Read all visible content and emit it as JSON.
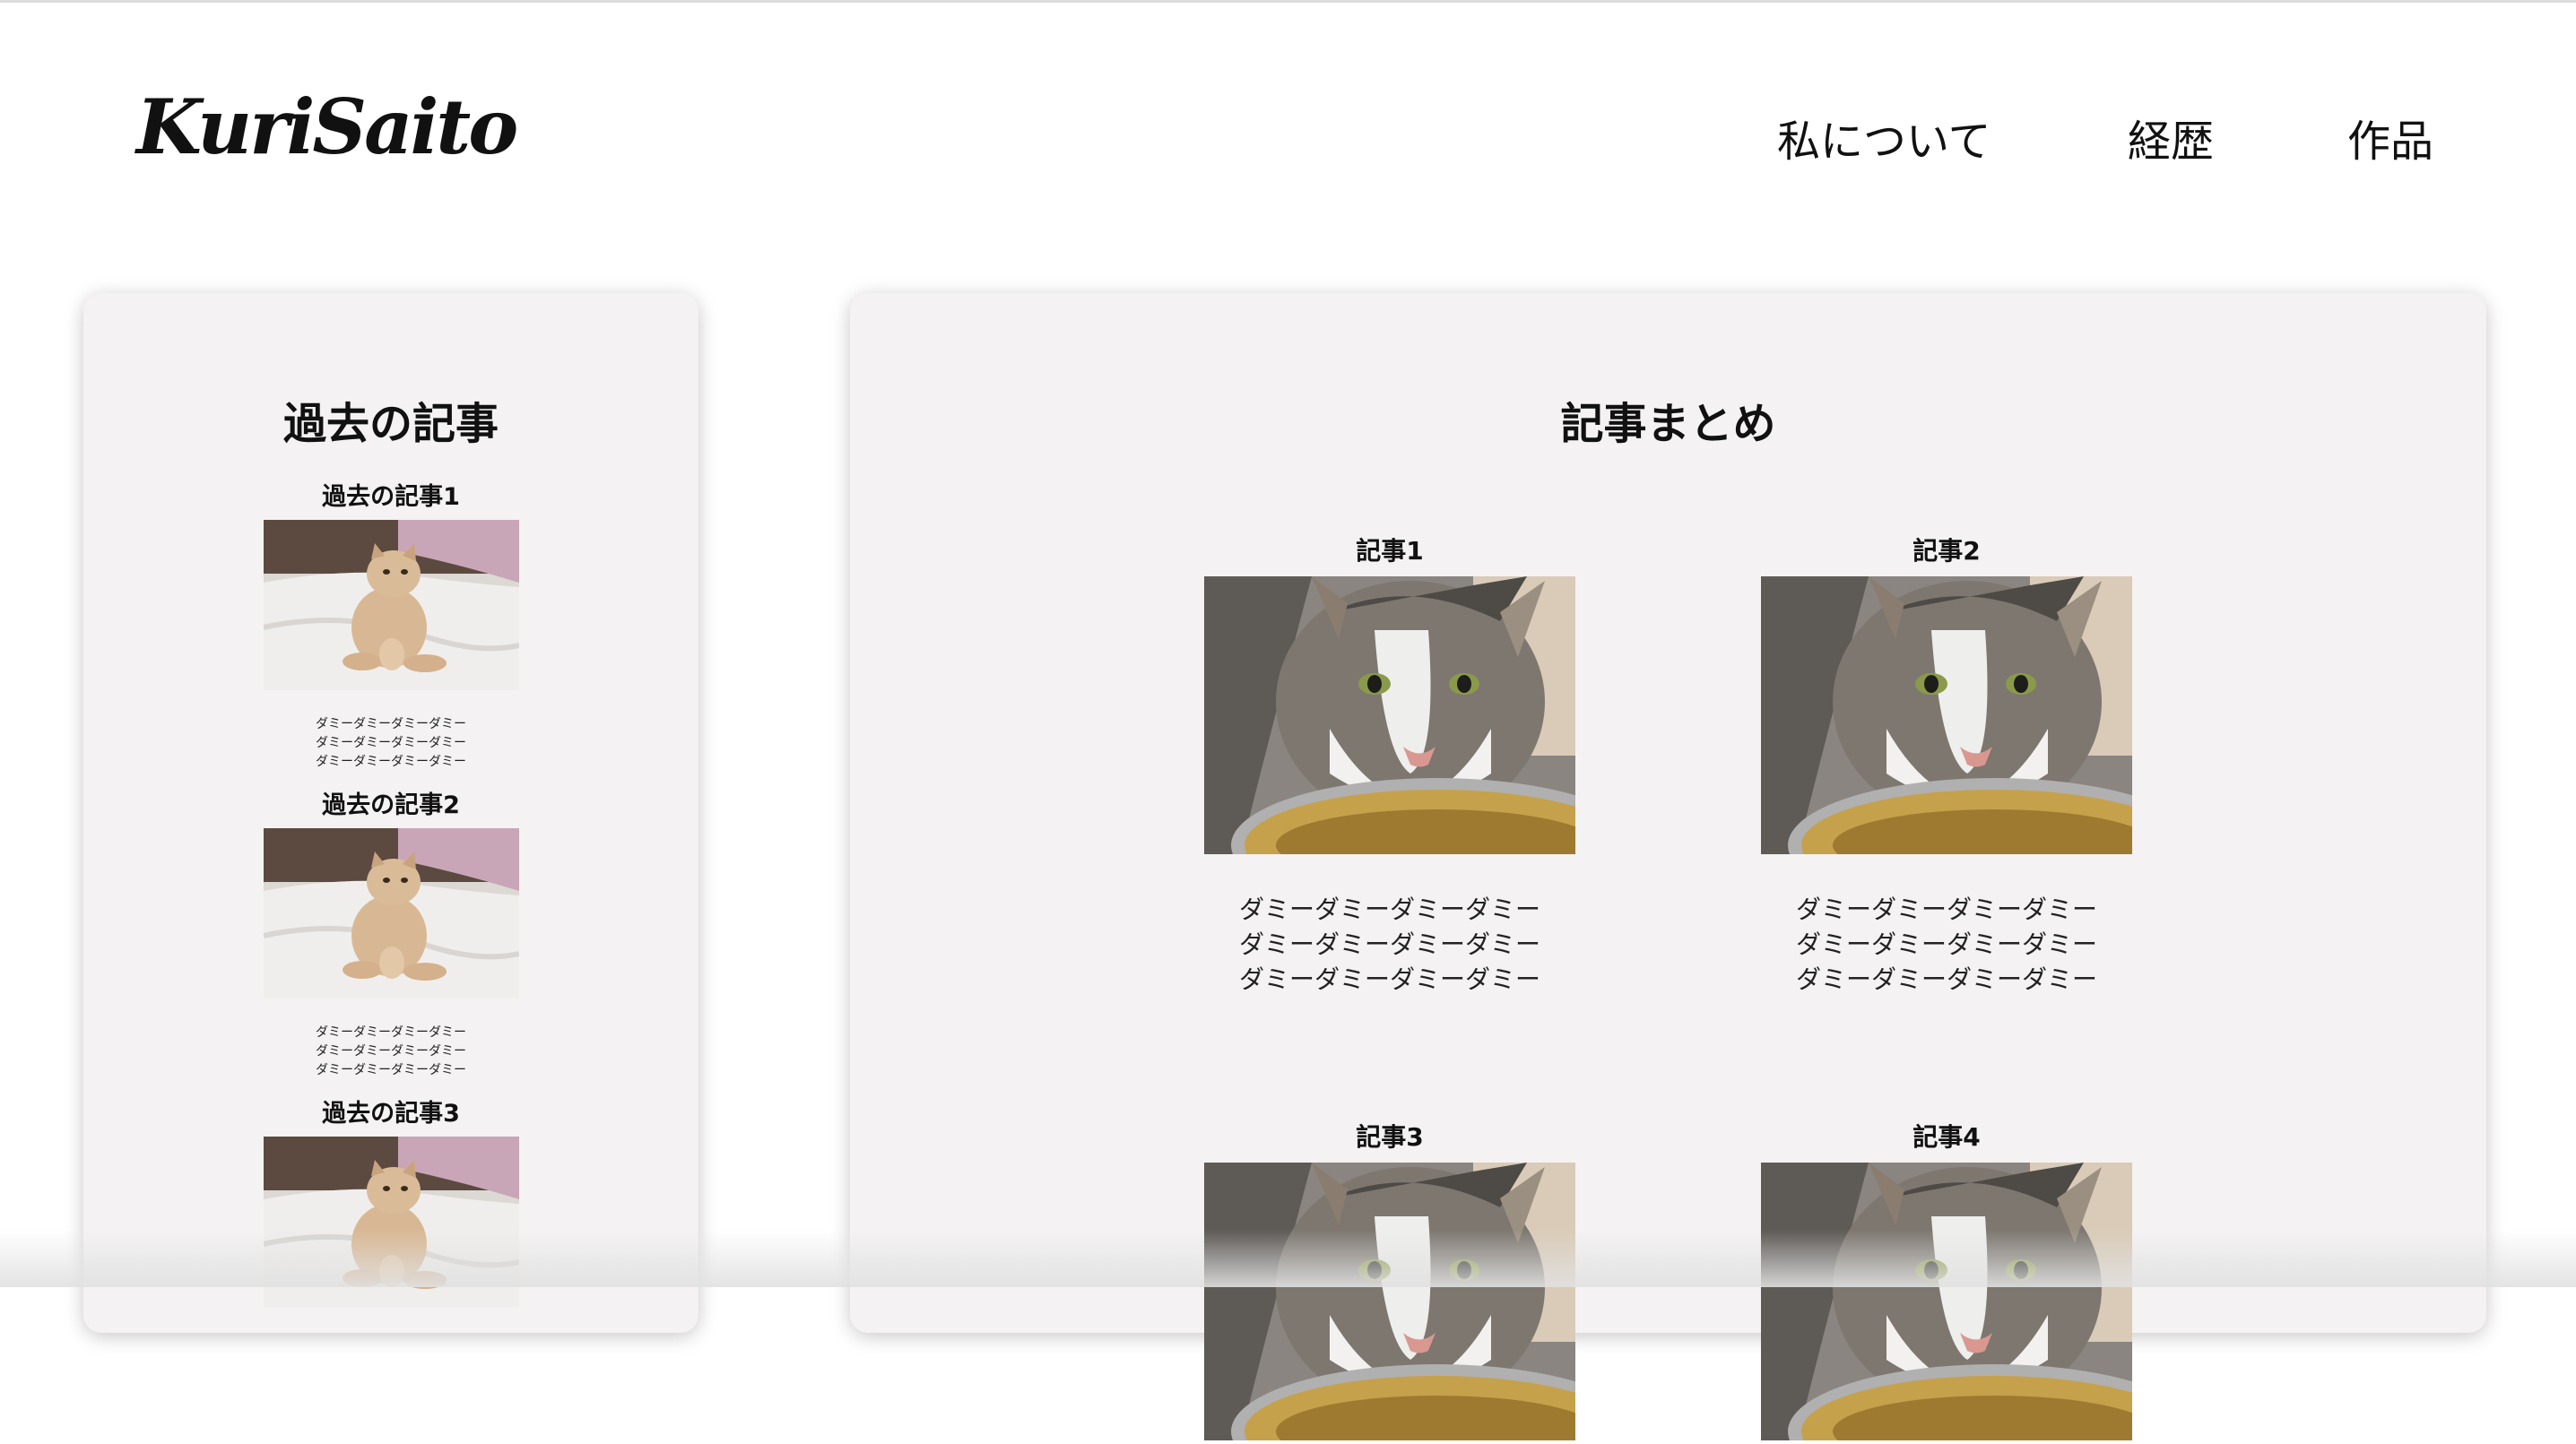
{
  "header": {
    "logo": "KuriSaito",
    "nav": [
      {
        "label": "私について"
      },
      {
        "label": "経歴"
      },
      {
        "label": "作品"
      }
    ]
  },
  "sidebar": {
    "title": "過去の記事",
    "items": [
      {
        "title": "過去の記事1",
        "lines": [
          "ダミーダミーダミーダミー",
          "ダミーダミーダミーダミー",
          "ダミーダミーダミーダミー"
        ]
      },
      {
        "title": "過去の記事2",
        "lines": [
          "ダミーダミーダミーダミー",
          "ダミーダミーダミーダミー",
          "ダミーダミーダミーダミー"
        ]
      },
      {
        "title": "過去の記事3",
        "lines": []
      }
    ]
  },
  "main": {
    "title": "記事まとめ",
    "articles": [
      {
        "title": "記事1",
        "lines": [
          "ダミーダミーダミーダミー",
          "ダミーダミーダミーダミー",
          "ダミーダミーダミーダミー"
        ]
      },
      {
        "title": "記事2",
        "lines": [
          "ダミーダミーダミーダミー",
          "ダミーダミーダミーダミー",
          "ダミーダミーダミーダミー"
        ]
      },
      {
        "title": "記事3",
        "lines": []
      },
      {
        "title": "記事4",
        "lines": []
      }
    ]
  },
  "icons": {
    "sidebar_image": "sitting-cat-photo",
    "article_image": "cat-eating-photo"
  }
}
